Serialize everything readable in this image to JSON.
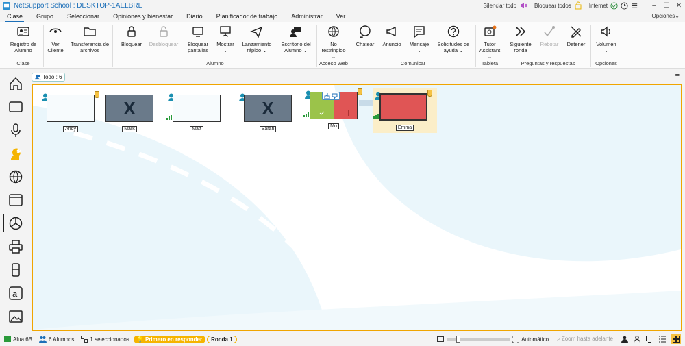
{
  "window": {
    "title": "NetSupport School : DESKTOP-1AELBRE"
  },
  "titlebar": {
    "mute_all": "Silenciar todo",
    "lock_all": "Bloquear todos",
    "internet": "Internet"
  },
  "menu": {
    "items": [
      "Clase",
      "Grupo",
      "Seleccionar",
      "Opiniones y bienestar",
      "Diario",
      "Planificador de trabajo",
      "Administrar",
      "Ver"
    ],
    "options": "Opciones"
  },
  "ribbon": {
    "buttons": {
      "registro": "Registro de Alumno",
      "ver_cliente": "Ver Cliente",
      "transferencia": "Transferencia de archivos",
      "bloquear": "Bloquear",
      "desbloquear": "Desbloquear",
      "bloquear_pantallas": "Bloquear pantallas",
      "mostrar": "Mostrar",
      "lanzamiento": "Lanzamiento rápido",
      "escritorio": "Escritorio del Alumno",
      "no_restringido": "No restringido",
      "chatear": "Chatear",
      "anuncio": "Anuncio",
      "mensaje": "Mensaje",
      "solicitudes": "Solicitudes de ayuda",
      "tutor": "Tutor Assistant",
      "siguiente": "Siguiente ronda",
      "rebotar": "Rebotar",
      "detener": "Detener",
      "volumen": "Volumen"
    },
    "groups": {
      "clase": "Clase",
      "alumno": "Alumno",
      "acceso_web": "Acceso Web",
      "comunicar": "Comunicar",
      "tableta": "Tableta",
      "preguntas": "Preguntas y respuestas",
      "opciones": "Opciones"
    }
  },
  "subbar": {
    "todo_chip": "Todo : 6"
  },
  "students": [
    {
      "name": "Andy",
      "state": "on"
    },
    {
      "name": "Mark",
      "state": "off"
    },
    {
      "name": "Matt",
      "state": "on"
    },
    {
      "name": "Sarah",
      "state": "off"
    },
    {
      "name": "Mo",
      "state": "quiz"
    },
    {
      "name": "Emma",
      "state": "selected"
    }
  ],
  "statusbar": {
    "room": "Alua 6B",
    "students": "6 Alumnos",
    "selected": "1 seleccionados",
    "first_to_answer": "Primero en responder",
    "round": "Ronda 1",
    "zoom_mode": "Automático",
    "zoom_fit": "Zoom hasta adelante"
  },
  "colors": {
    "accent": "#1c6fb8",
    "canvas_border": "#f0a500",
    "answer_red": "#e05555",
    "answer_green": "#9bc34a"
  }
}
